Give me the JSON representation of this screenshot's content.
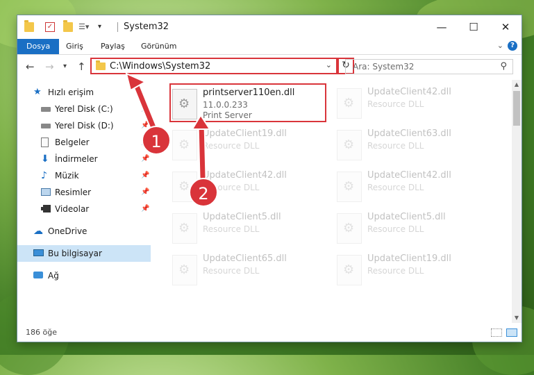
{
  "window": {
    "title": "System32",
    "controls": {
      "minimize": "—",
      "maximize": "☐",
      "close": "✕"
    }
  },
  "ribbon": {
    "tabs": [
      {
        "label": "Dosya",
        "active": true
      },
      {
        "label": "Giriş"
      },
      {
        "label": "Paylaş"
      },
      {
        "label": "Görünüm"
      }
    ],
    "help": "?"
  },
  "nav": {
    "address": "C:\\Windows\\System32",
    "search_placeholder": "Ara: System32"
  },
  "sidebar": {
    "items": [
      {
        "label": "Hızlı erişim",
        "icon": "star-icon"
      },
      {
        "label": "Yerel Disk (C:)",
        "icon": "drive-icon",
        "pinned": true
      },
      {
        "label": "Yerel Disk (D:)",
        "icon": "drive-icon",
        "pinned": true
      },
      {
        "label": "Belgeler",
        "icon": "documents-icon",
        "pinned": true
      },
      {
        "label": "İndirmeler",
        "icon": "download-icon",
        "pinned": true
      },
      {
        "label": "Müzik",
        "icon": "music-icon",
        "pinned": true
      },
      {
        "label": "Resimler",
        "icon": "pictures-icon",
        "pinned": true
      },
      {
        "label": "Videolar",
        "icon": "videos-icon",
        "pinned": true
      },
      {
        "label": "OneDrive",
        "icon": "cloud-icon"
      },
      {
        "label": "Bu bilgisayar",
        "icon": "computer-icon",
        "selected": true
      },
      {
        "label": "Ağ",
        "icon": "network-icon"
      }
    ]
  },
  "files": {
    "highlight": {
      "name": "printserver110en.dll",
      "version": "11.0.0.233",
      "desc": "Print Server"
    },
    "left": [
      {
        "name": "UpdateClient19.dll",
        "desc": "Resource DLL"
      },
      {
        "name": "UpdateClient42.dll",
        "desc": "Resource DLL"
      },
      {
        "name": "UpdateClient5.dll",
        "desc": "Resource DLL"
      },
      {
        "name": "UpdateClient65.dll",
        "desc": "Resource DLL"
      }
    ],
    "right": [
      {
        "name": "UpdateClient42.dll",
        "desc": "Resource DLL"
      },
      {
        "name": "UpdateClient63.dll",
        "desc": "Resource DLL"
      },
      {
        "name": "UpdateClient42.dll",
        "desc": "Resource DLL"
      },
      {
        "name": "UpdateClient5.dll",
        "desc": "Resource DLL"
      },
      {
        "name": "UpdateClient19.dll",
        "desc": "Resource DLL"
      }
    ]
  },
  "status": {
    "count": "186 öğe"
  },
  "annotations": {
    "step1": "1",
    "step2": "2"
  },
  "colors": {
    "accent": "#1a6fc4",
    "highlight": "#d9343a",
    "selected": "#cce4f7"
  }
}
